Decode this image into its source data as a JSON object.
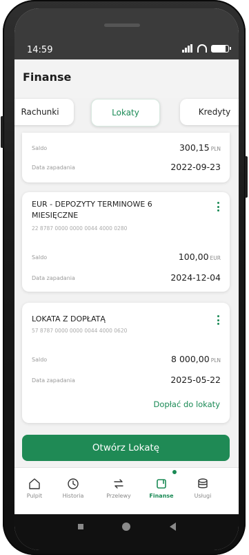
{
  "status": {
    "time": "14:59"
  },
  "header": {
    "title": "Finanse"
  },
  "tabs": [
    {
      "label": "Rachunki"
    },
    {
      "label": "Lokaty"
    },
    {
      "label": "Kredyty"
    }
  ],
  "cards": [
    {
      "saldo_label": "Saldo",
      "saldo_value": "300,15",
      "saldo_currency": "PLN",
      "date_label": "Data zapadania",
      "date_value": "2022-09-23"
    },
    {
      "title": "EUR - DEPOZYTY TERMINOWE 6 MIESIĘCZNE",
      "account": "22 8787 0000 0000 0044 4000 0280",
      "saldo_label": "Saldo",
      "saldo_value": "100,00",
      "saldo_currency": "EUR",
      "date_label": "Data zapadania",
      "date_value": "2024-12-04"
    },
    {
      "title": "LOKATA Z DOPŁATĄ",
      "account": "57 8787 0000 0000 0044 4000 0620",
      "saldo_label": "Saldo",
      "saldo_value": "8 000,00",
      "saldo_currency": "PLN",
      "date_label": "Data zapadania",
      "date_value": "2025-05-22",
      "link": "Dopłać do lokaty"
    }
  ],
  "cta": {
    "label": "Otwórz Lokatę"
  },
  "bottom_nav": [
    {
      "label": "Pulpit",
      "icon": "home-icon"
    },
    {
      "label": "Historia",
      "icon": "history-icon"
    },
    {
      "label": "Przelewy",
      "icon": "transfer-icon"
    },
    {
      "label": "Finanse",
      "icon": "finance-icon",
      "active": true
    },
    {
      "label": "Usługi",
      "icon": "services-icon"
    }
  ],
  "colors": {
    "accent": "#1a8a55",
    "button": "#1f8a55"
  }
}
